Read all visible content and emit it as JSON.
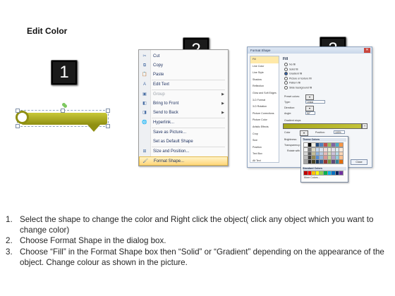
{
  "title": "Edit Color",
  "badges": [
    "1",
    "2",
    "3"
  ],
  "context_menu": {
    "items": [
      {
        "icon": "scissors-icon",
        "glyph": "✂",
        "label": "Cut",
        "disabled": false,
        "arrow": false
      },
      {
        "icon": "copy-icon",
        "glyph": "⧉",
        "label": "Copy",
        "disabled": false,
        "arrow": false
      },
      {
        "icon": "paste-icon",
        "glyph": "📋",
        "label": "Paste",
        "disabled": false,
        "arrow": false
      },
      {
        "icon": "edit-text-icon",
        "glyph": "A",
        "label": "Edit Text",
        "disabled": false,
        "arrow": false
      },
      {
        "icon": "group-icon",
        "glyph": "▣",
        "label": "Group",
        "disabled": true,
        "arrow": true
      },
      {
        "icon": "bring-to-front-icon",
        "glyph": "◧",
        "label": "Bring to Front",
        "disabled": false,
        "arrow": true
      },
      {
        "icon": "send-to-back-icon",
        "glyph": "◨",
        "label": "Send to Back",
        "disabled": false,
        "arrow": true
      },
      {
        "icon": "hyperlink-icon",
        "glyph": "🌐",
        "label": "Hyperlink...",
        "disabled": false,
        "arrow": false
      },
      {
        "icon": "save-picture-icon",
        "glyph": "",
        "label": "Save as Picture...",
        "disabled": false,
        "arrow": false
      },
      {
        "icon": "default-shape-icon",
        "glyph": "",
        "label": "Set as Default Shape",
        "disabled": false,
        "arrow": false
      },
      {
        "icon": "size-position-icon",
        "glyph": "⊞",
        "label": "Size and Position...",
        "disabled": false,
        "arrow": false
      },
      {
        "icon": "format-shape-icon",
        "glyph": "🖌",
        "label": "Format Shape...",
        "disabled": false,
        "arrow": false
      }
    ]
  },
  "dialog": {
    "title": "Format Shape",
    "sidebar": [
      "Fill",
      "Line Color",
      "Line Style",
      "Shadow",
      "Reflection",
      "Glow and Soft Edges",
      "3-D Format",
      "3-D Rotation",
      "Picture Corrections",
      "Picture Color",
      "Artistic Effects",
      "Crop",
      "Size",
      "Position",
      "Text Box",
      "Alt Text"
    ],
    "fill_heading": "Fill",
    "options": [
      "No fill",
      "Solid fill",
      "Gradient fill",
      "Picture or texture fill",
      "Pattern fill",
      "Slide background fill"
    ],
    "preset_label": "Preset colors:",
    "type_label": "Type:",
    "type_value": "Linear",
    "direction_label": "Direction:",
    "angle_label": "Angle:",
    "angle_value": "90°",
    "stops_label": "Gradient stops",
    "color_label": "Color",
    "position_label": "Position:",
    "position_value": "100%",
    "brightness_label": "Brightness:",
    "transparency_label": "Transparency:",
    "rotate_label": "Rotate with shape",
    "close_label": "Close"
  },
  "palette": {
    "theme_label": "Theme Colors",
    "standard_label": "Standard Colors",
    "more_label": "More Colors...",
    "theme_colors": [
      "#ffffff",
      "#000000",
      "#eeece1",
      "#1f497d",
      "#4f81bd",
      "#c0504d",
      "#9bbb59",
      "#8064a2",
      "#4bacc6",
      "#f79646"
    ],
    "theme_tints": [
      "#f2f2f2",
      "#7f7f7f",
      "#ddd9c3",
      "#c6d9f0",
      "#dbe5f1",
      "#f2dcdb",
      "#ebf1dd",
      "#e5e0ec",
      "#dbeef3",
      "#fdeada",
      "#d8d8d8",
      "#595959",
      "#c4bd97",
      "#8db3e2",
      "#b8cce4",
      "#e5b9b7",
      "#d7e3bc",
      "#ccc1d9",
      "#b7dde8",
      "#fbd5b5",
      "#bfbfbf",
      "#3f3f3f",
      "#938953",
      "#548dd4",
      "#95b3d7",
      "#d99694",
      "#c3d69b",
      "#b2a2c7",
      "#92cddc",
      "#fac08f",
      "#a5a5a5",
      "#262626",
      "#494429",
      "#17365d",
      "#366092",
      "#953734",
      "#76923c",
      "#5f497a",
      "#31859b",
      "#e36c09"
    ],
    "standard_colors": [
      "#c00000",
      "#ff0000",
      "#ffc000",
      "#ffff00",
      "#92d050",
      "#00b050",
      "#00b0f0",
      "#0070c0",
      "#002060",
      "#7030a0"
    ]
  },
  "instructions": [
    {
      "num": "1.",
      "text": "Select the shape to change the color and Right click the object( click any object which you want to change color)"
    },
    {
      "num": "2.",
      "text": "Choose Format Shape in the dialog box."
    },
    {
      "num": "3.",
      "text": "Choose “Fill” in the Format Shape box then “Solid” or “Gradient” depending on the appearance of the object. Change colour as shown in the picture."
    }
  ]
}
